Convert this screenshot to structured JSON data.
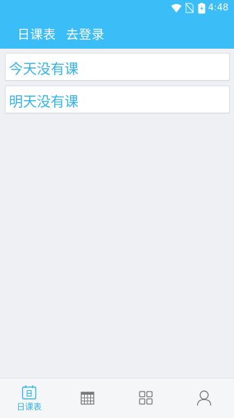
{
  "status": {
    "time": "4:48"
  },
  "header": {
    "day_schedule_label": "日课表",
    "login_label": "去登录"
  },
  "cards": [
    {
      "text": "今天没有课"
    },
    {
      "text": "明天没有课"
    }
  ],
  "bottom_nav": {
    "items": [
      {
        "label": "日课表",
        "icon": "day-calendar-icon",
        "active": true
      },
      {
        "label": "",
        "icon": "week-table-icon",
        "active": false
      },
      {
        "label": "",
        "icon": "grid-apps-icon",
        "active": false
      },
      {
        "label": "",
        "icon": "profile-icon",
        "active": false
      }
    ]
  },
  "colors": {
    "accent": "#3bbdf7",
    "card_text": "#33b4ea",
    "background": "#eef0f3"
  }
}
